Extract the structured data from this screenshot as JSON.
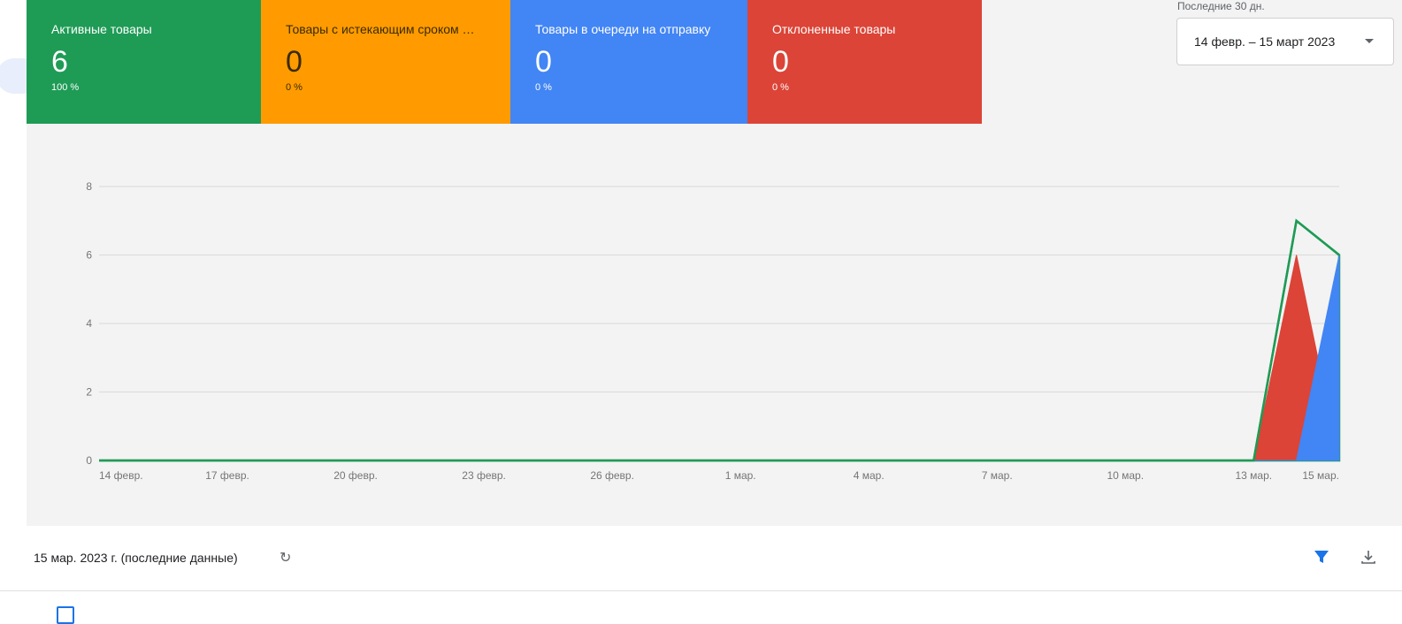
{
  "cards": [
    {
      "label": "Активные товары",
      "value": "6",
      "percent": "100 %",
      "color": "#1e9b55"
    },
    {
      "label": "Товары с истекающим сроком …",
      "value": "0",
      "percent": "0 %",
      "color": "#ff9b00"
    },
    {
      "label": "Товары в очереди на отправку",
      "value": "0",
      "percent": "0 %",
      "color": "#4285f4"
    },
    {
      "label": "Отклоненные товары",
      "value": "0",
      "percent": "0 %",
      "color": "#db4437"
    }
  ],
  "period": {
    "label": "Последние 30 дн.",
    "value": "14 февр. – 15 март 2023"
  },
  "toolbar": {
    "date": "15 мар. 2023 г. (последние данные)",
    "refresh_icon": "refresh-icon",
    "filter_icon": "filter-icon",
    "download_icon": "download-icon"
  },
  "chart_data": {
    "type": "area",
    "x": [
      "14 февр.",
      "15 февр.",
      "16 февр.",
      "17 февр.",
      "18 февр.",
      "19 февр.",
      "20 февр.",
      "21 февр.",
      "22 февр.",
      "23 февр.",
      "24 февр.",
      "25 февр.",
      "26 февр.",
      "27 февр.",
      "28 февр.",
      "1 мар.",
      "2 мар.",
      "3 мар.",
      "4 мар.",
      "5 мар.",
      "6 мар.",
      "7 мар.",
      "8 мар.",
      "9 мар.",
      "10 мар.",
      "11 мар.",
      "12 мар.",
      "13 мар.",
      "14 мар.",
      "15 мар."
    ],
    "tick_labels": [
      "14 февр.",
      "17 февр.",
      "20 февр.",
      "23 февр.",
      "26 февр.",
      "1 мар.",
      "4 мар.",
      "7 мар.",
      "10 мар.",
      "13 мар.",
      "15 мар."
    ],
    "yticks": [
      0,
      2,
      4,
      6,
      8
    ],
    "ylim": [
      0,
      8.5
    ],
    "series": [
      {
        "color": "#1e9b55",
        "values": [
          0,
          0,
          0,
          0,
          0,
          0,
          0,
          0,
          0,
          0,
          0,
          0,
          0,
          0,
          0,
          0,
          0,
          0,
          0,
          0,
          0,
          0,
          0,
          0,
          0,
          0,
          0,
          0,
          7,
          6
        ]
      },
      {
        "color": "#db4437",
        "values": [
          0,
          0,
          0,
          0,
          0,
          0,
          0,
          0,
          0,
          0,
          0,
          0,
          0,
          0,
          0,
          0,
          0,
          0,
          0,
          0,
          0,
          0,
          0,
          0,
          0,
          0,
          0,
          0,
          6,
          0
        ]
      },
      {
        "color": "#4285f4",
        "values": [
          0,
          0,
          0,
          0,
          0,
          0,
          0,
          0,
          0,
          0,
          0,
          0,
          0,
          0,
          0,
          0,
          0,
          0,
          0,
          0,
          0,
          0,
          0,
          0,
          0,
          0,
          0,
          0,
          0,
          6
        ]
      }
    ],
    "grid": true
  }
}
